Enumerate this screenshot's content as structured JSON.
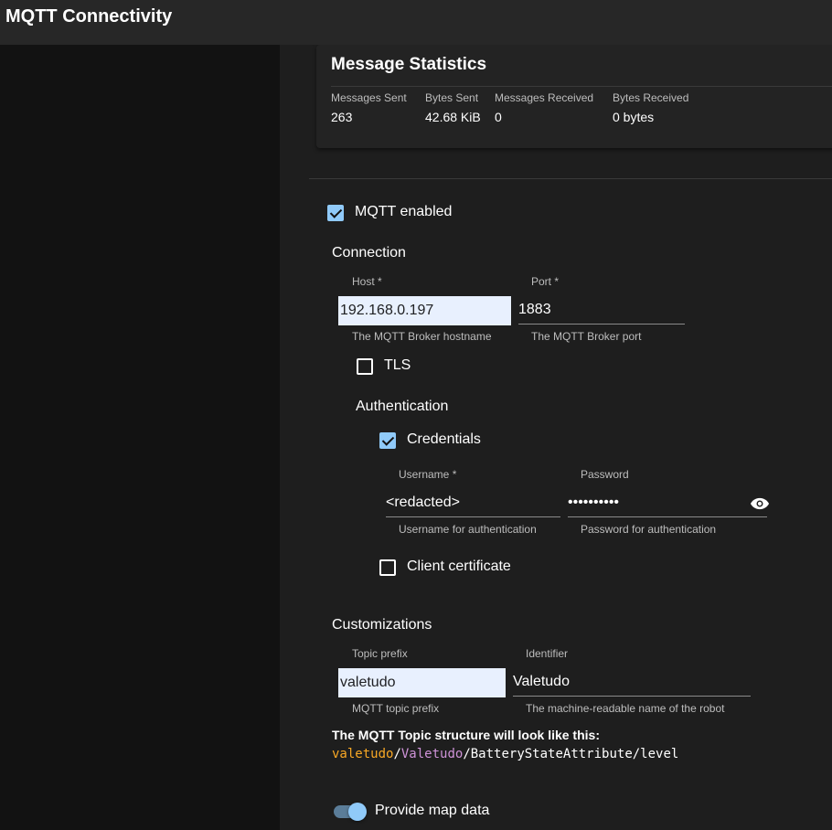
{
  "appbar": {
    "title": "MQTT Connectivity"
  },
  "stats": {
    "title": "Message Statistics",
    "items": [
      {
        "label": "Messages Sent",
        "value": "263"
      },
      {
        "label": "Bytes Sent",
        "value": "42.68 KiB"
      },
      {
        "label": "Messages Received",
        "value": "0"
      },
      {
        "label": "Bytes Received",
        "value": "0 bytes"
      }
    ]
  },
  "mqtt": {
    "enabled_label": "MQTT enabled",
    "enabled": true
  },
  "connection": {
    "heading": "Connection",
    "host": {
      "label": "Host *",
      "value": "192.168.0.197",
      "help": "The MQTT Broker hostname"
    },
    "port": {
      "label": "Port *",
      "value": "1883",
      "help": "The MQTT Broker port"
    },
    "tls": {
      "label": "TLS",
      "checked": false
    }
  },
  "authentication": {
    "heading": "Authentication",
    "credentials": {
      "label": "Credentials",
      "checked": true
    },
    "username": {
      "label": "Username *",
      "value": "<redacted>",
      "help": "Username for authentication"
    },
    "password": {
      "label": "Password",
      "value": "••••••••••",
      "help": "Password for authentication",
      "toggle_icon": "eye-icon"
    },
    "client_certificate": {
      "label": "Client certificate",
      "checked": false
    }
  },
  "customizations": {
    "heading": "Customizations",
    "topic_prefix": {
      "label": "Topic prefix",
      "value": "valetudo",
      "help": "MQTT topic prefix"
    },
    "identifier": {
      "label": "Identifier",
      "value": "Valetudo",
      "help": "The machine-readable name of the robot"
    },
    "topic_structure": {
      "title": "The MQTT Topic structure will look like this:",
      "prefix": "valetudo",
      "sep1": "/",
      "identifier": "Valetudo",
      "sep2": "/",
      "rest": "BatteryStateAttribute/level",
      "prefix_color": "#f9a825",
      "identifier_color": "#ce93d8"
    }
  },
  "provide_map": {
    "label": "Provide map data",
    "on": true
  },
  "colors": {
    "accent": "#90caf9",
    "background": "#121212",
    "surface": "#1e1e1e",
    "appbar": "#272727"
  }
}
